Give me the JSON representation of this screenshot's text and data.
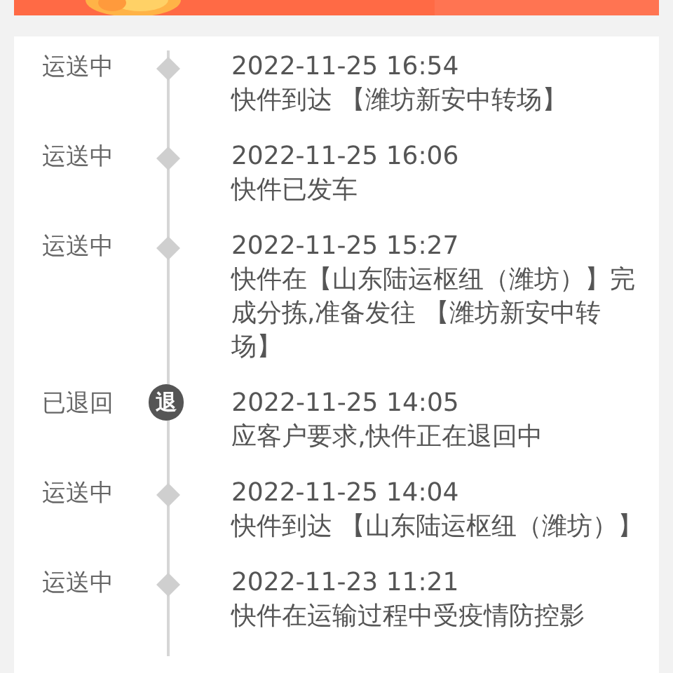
{
  "events": [
    {
      "status": "运送中",
      "kind": "transit",
      "time": "2022-11-25 16:54",
      "description": "快件到达 【潍坊新安中转场】"
    },
    {
      "status": "运送中",
      "kind": "transit",
      "time": "2022-11-25 16:06",
      "description": "快件已发车"
    },
    {
      "status": "运送中",
      "kind": "transit",
      "time": "2022-11-25 15:27",
      "description": "快件在【山东陆运枢纽（潍坊）】完成分拣,准备发往 【潍坊新安中转场】"
    },
    {
      "status": "已退回",
      "kind": "return",
      "badge": "退",
      "time": "2022-11-25 14:05",
      "description": "应客户要求,快件正在退回中"
    },
    {
      "status": "运送中",
      "kind": "transit",
      "time": "2022-11-25 14:04",
      "description": "快件到达 【山东陆运枢纽（潍坊）】"
    },
    {
      "status": "运送中",
      "kind": "transit",
      "time": "2022-11-23 11:21",
      "description": "快件在运输过程中受疫情防控影"
    }
  ]
}
